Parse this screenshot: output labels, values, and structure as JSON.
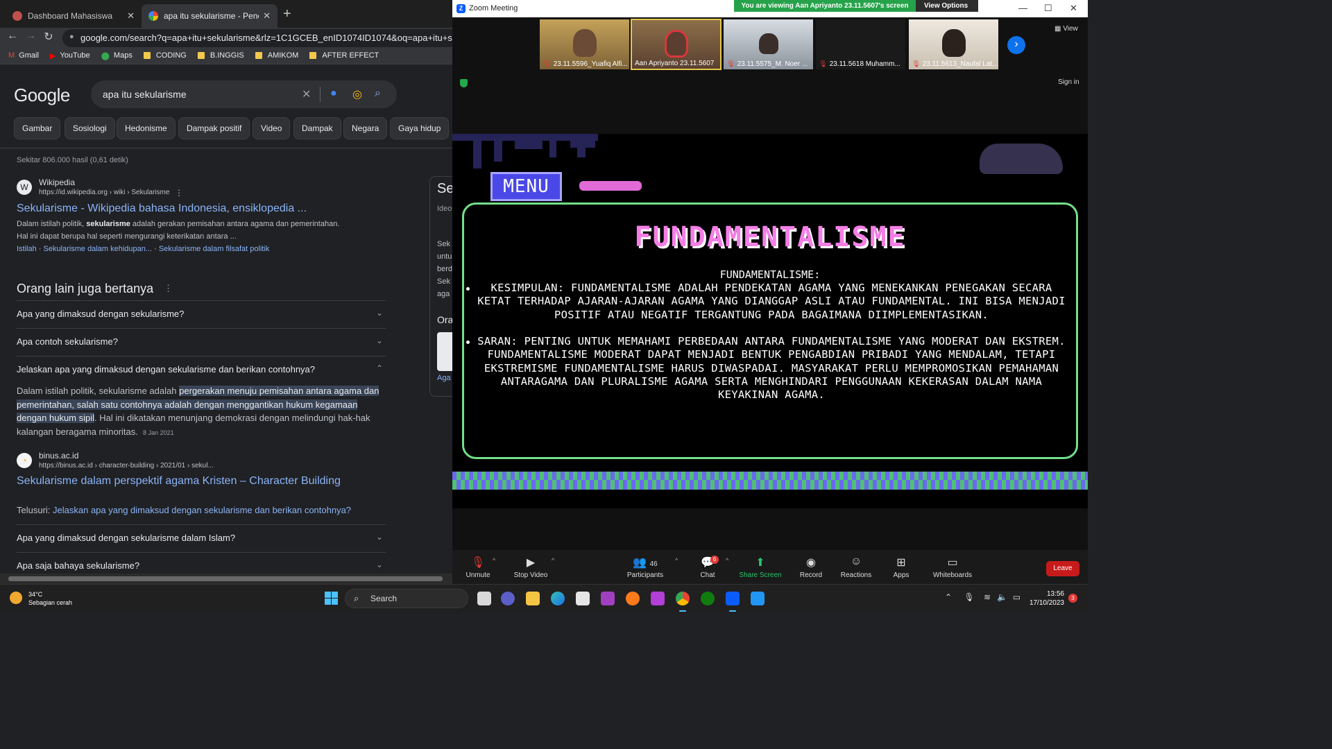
{
  "chrome": {
    "tabs": [
      {
        "title": "Dashboard Mahasiswa",
        "active": false
      },
      {
        "title": "apa itu sekularisme - Penelusuran",
        "active": true
      }
    ],
    "url": "google.com/search?q=apa+itu+sekularisme&rlz=1C1GCEB_enID1074ID1074&oq=apa+itu+sekularisme&",
    "bookmarks": [
      "Gmail",
      "YouTube",
      "Maps",
      "CODING",
      "B.INGGIS",
      "AMIKOM",
      "AFTER EFFECT"
    ]
  },
  "google": {
    "logo": "Google",
    "query": "apa itu sekularisme",
    "chips": [
      "Gambar",
      "Sosiologi",
      "Hedonisme",
      "Dampak positif",
      "Video",
      "Dampak",
      "Negara",
      "Gaya hidup"
    ],
    "stats": "Sekitar 806.000 hasil (0,61 detik)",
    "result1": {
      "site": "Wikipedia",
      "cite": "https://id.wikipedia.org › wiki › Sekularisme",
      "title": "Sekularisme - Wikipedia bahasa Indonesia, ensiklopedia ...",
      "snippet_pre": "Dalam istilah politik, ",
      "snippet_bold": "sekularisme",
      "snippet_post": " adalah gerakan pemisahan antara agama dan pemerintahan.",
      "snippet_line2": "Hal ini dapat berupa hal seperti mengurangi keterikatan antara ...",
      "sitelink1": "Istilah",
      "sitelink2": "Sekularisme dalam kehidupan...",
      "sitelink3": "Sekularisme dalam filsafat politik"
    },
    "paa_heading": "Orang lain juga bertanya",
    "questions": [
      "Apa yang dimaksud dengan sekularisme?",
      "Apa contoh sekularisme?",
      "Jelaskan apa yang dimaksud dengan sekularisme dan berikan contohnya?"
    ],
    "answer": {
      "pre": "Dalam istilah politik, sekularisme adalah ",
      "highlight": "pergerakan menuju pemisahan antara agama dan pemerintahan, salah satu contohnya adalah dengan menggantikan hukum kegamaan dengan hukum sipil",
      "post": ". Hal ini dikatakan menunjang demokrasi dengan melindungi hak-hak kalangan beragama minoritas.",
      "date": "8 Jan 2021"
    },
    "result2": {
      "site": "binus.ac.id",
      "cite": "https://binus.ac.id › character-building › 2021/01 › sekul...",
      "title": "Sekularisme dalam perspektif agama Kristen – Character Building"
    },
    "telusuri_label": "Telusuri: ",
    "telusuri_link": "Jelaskan apa yang dimaksud dengan sekularisme dan berikan contohnya?",
    "questions_more": [
      "Apa yang dimaksud dengan sekularisme dalam Islam?",
      "Apa saja bahaya sekularisme?"
    ],
    "side_panel": {
      "title": "Se",
      "sub": "Ideo",
      "lines": [
        "Sek",
        "untu",
        "berd",
        "Sek",
        "aga"
      ],
      "ora": "Ora",
      "aga": "Aga"
    }
  },
  "zoom": {
    "title": "Zoom Meeting",
    "viewing": "You are viewing Aan Apriyanto 23.11.5607's screen",
    "view_options": "View Options",
    "view_label": "View",
    "signin": "Sign in",
    "participants": [
      {
        "name": "23.11.5596_Yuafiq Alfi...",
        "muted": true
      },
      {
        "name": "Aan Apriyanto 23.11.5607",
        "muted": false
      },
      {
        "name": "23.11.5575_M. Noer ...",
        "muted": true
      },
      {
        "name": "23.11.5618 Muhamm...",
        "muted": true
      },
      {
        "name": "23.11.5613_Naufal Lat...",
        "muted": true
      }
    ],
    "slide": {
      "menu": "MENU",
      "title": "FUNDAMENTALISME",
      "subtitle": "FUNDAMENTALISME:",
      "bullet1": "KESIMPULAN: FUNDAMENTALISME ADALAH PENDEKATAN AGAMA YANG MENEKANKAN PENEGAKAN SECARA KETAT TERHADAP AJARAN-AJARAN AGAMA YANG DIANGGAP ASLI ATAU FUNDAMENTAL. INI BISA MENJADI POSITIF ATAU NEGATIF TERGANTUNG PADA BAGAIMANA DIIMPLEMENTASIKAN.",
      "bullet2": "SARAN: PENTING UNTUK MEMAHAMI PERBEDAAN ANTARA FUNDAMENTALISME YANG MODERAT DAN EKSTREM. FUNDAMENTALISME MODERAT DAPAT MENJADI BENTUK PENGABDIAN PRIBADI YANG MENDALAM, TETAPI EKSTREMISME FUNDAMENTALISME HARUS DIWASPADAI. MASYARAKAT PERLU MEMPROMOSIKAN PEMAHAMAN ANTARAGAMA DAN PLURALISME AGAMA SERTA MENGHINDARI PENGGUNAAN KEKERASAN DALAM NAMA KEYAKINAN AGAMA."
    },
    "toolbar": {
      "unmute": "Unmute",
      "stop_video": "Stop Video",
      "participants": "Participants",
      "participants_count": "46",
      "chat": "Chat",
      "chat_badge": "6",
      "share": "Share Screen",
      "record": "Record",
      "reactions": "Reactions",
      "apps": "Apps",
      "whiteboards": "Whiteboards",
      "leave": "Leave"
    }
  },
  "taskbar": {
    "temp": "34°C",
    "weather": "Sebagian cerah",
    "search": "Search",
    "time": "13:56",
    "date": "17/10/2023",
    "notifications": "3"
  },
  "colors": {
    "google_link": "#8ab4f8",
    "zoom_accent": "#0e72ed",
    "slide_title": "#f57ee6",
    "slide_border": "#73e08a",
    "leave": "#c71b1b"
  }
}
